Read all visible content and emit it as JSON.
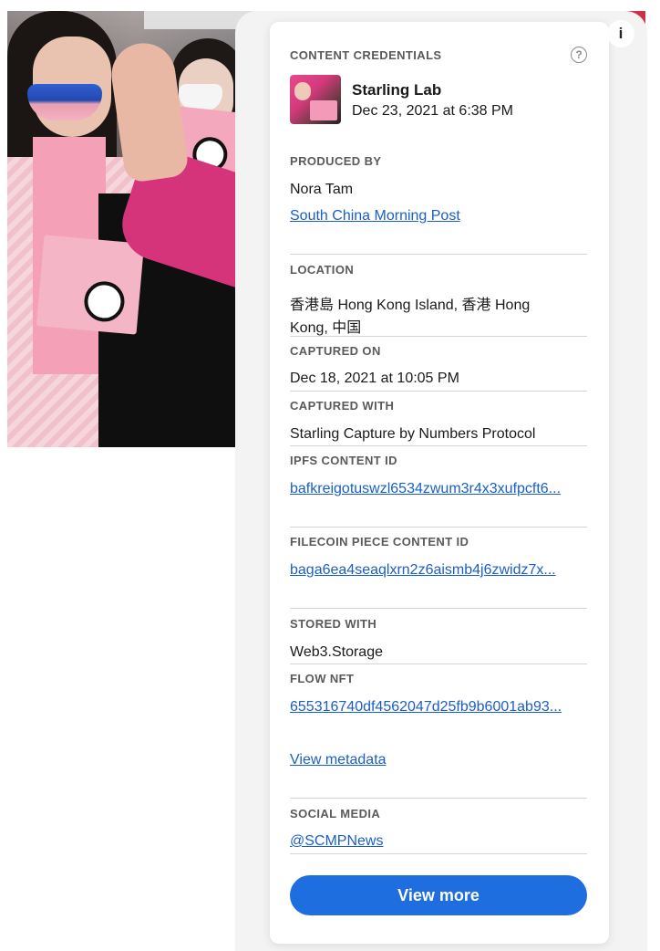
{
  "panel": {
    "title": "CONTENT CREDENTIALS",
    "help_icon": "?",
    "signer": {
      "name": "Starling Lab",
      "date": "Dec 23, 2021 at 6:38 PM"
    },
    "produced_by": {
      "label": "PRODUCED BY",
      "person": "Nora Tam",
      "org_link": "South China Morning Post"
    },
    "location": {
      "label": "LOCATION",
      "line1": "香港島 Hong Kong Island, 香港 Hong",
      "line2": "Kong, 中国"
    },
    "captured_on": {
      "label": "CAPTURED ON",
      "value": "Dec 18, 2021 at 10:05 PM"
    },
    "captured_with": {
      "label": "CAPTURED WITH",
      "value": "Starling Capture by Numbers Protocol"
    },
    "ipfs": {
      "label": "IPFS CONTENT ID",
      "value": "bafkreigotuswzl6534zwum3r4x3xufpcft6..."
    },
    "filecoin": {
      "label": "FILECOIN PIECE CONTENT ID",
      "value": "baga6ea4seaqlxrn2z6aismb4j6zwidz7x..."
    },
    "stored_with": {
      "label": "STORED WITH",
      "value": "Web3.Storage"
    },
    "flow_nft": {
      "label": "FLOW NFT",
      "value": "655316740df4562047d25fb9b6001ab93..."
    },
    "view_metadata": "View metadata",
    "social": {
      "label": "SOCIAL MEDIA",
      "handle": "@SCMPNews"
    },
    "view_more": "View more"
  },
  "info_icon": "i",
  "icons": {
    "info": "info-icon",
    "help": "question-mark-icon"
  },
  "colors": {
    "link": "#1a5fc9",
    "button": "#1f6ee0"
  }
}
